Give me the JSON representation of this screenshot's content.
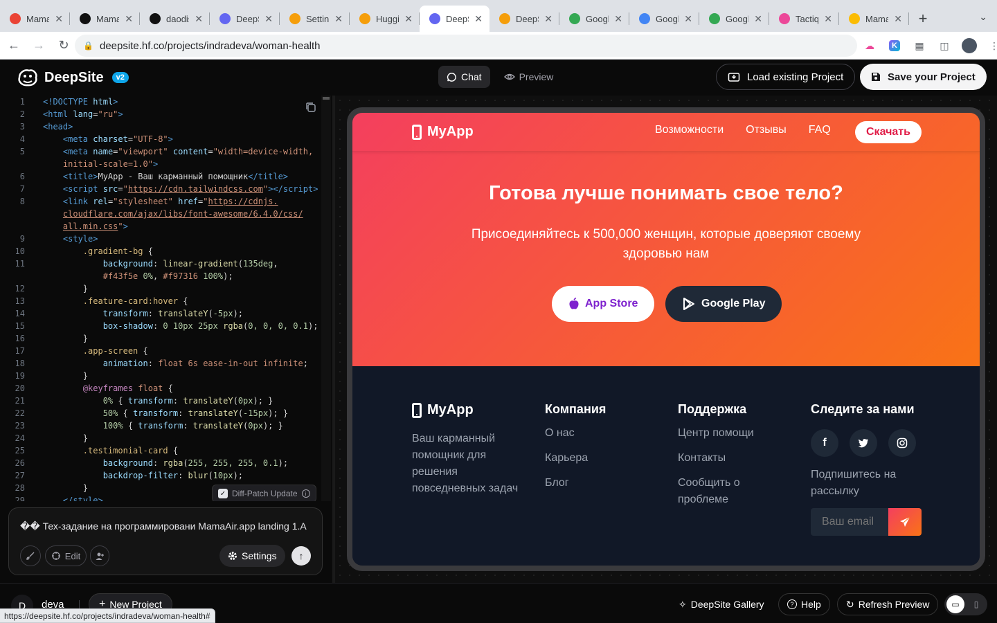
{
  "browser": {
    "tabs": [
      {
        "title": "Mama",
        "color": "#ea4335",
        "icon": "figma-icon"
      },
      {
        "title": "Mama",
        "color": "#111111",
        "icon": "github-icon"
      },
      {
        "title": "daodis",
        "color": "#111111",
        "icon": "github-icon"
      },
      {
        "title": "DeepS",
        "color": "#6366f1",
        "icon": "deepsite-icon"
      },
      {
        "title": "Setting",
        "color": "#f59e0b",
        "icon": "huggingface-icon"
      },
      {
        "title": "Huggin",
        "color": "#f59e0b",
        "icon": "huggingface-icon"
      },
      {
        "title": "DeepS",
        "color": "#6366f1",
        "icon": "deepsite-icon",
        "active": true
      },
      {
        "title": "DeepS",
        "color": "#f59e0b",
        "icon": "deepsite-icon"
      },
      {
        "title": "Google",
        "color": "#34a853",
        "icon": "google-meet-icon"
      },
      {
        "title": "Googl",
        "color": "#4285f4",
        "icon": "google-calendar-icon"
      },
      {
        "title": "Googl",
        "color": "#34a853",
        "icon": "google-meet-icon"
      },
      {
        "title": "Tactiq",
        "color": "#ec4899",
        "icon": "tactiq-icon"
      },
      {
        "title": "Mama",
        "color": "#fbbc04",
        "icon": "google-drive-icon"
      }
    ],
    "url": "deepsite.hf.co/projects/indradeva/woman-health",
    "status_url": "https://deepsite.hf.co/projects/indradeva/woman-health#"
  },
  "app": {
    "name": "DeepSite",
    "version": "v2",
    "mode_chat": "Chat",
    "mode_preview": "Preview",
    "load_project": "Load existing Project",
    "save_project": "Save your Project"
  },
  "editor": {
    "diff_patch": "Diff-Patch Update",
    "lines": [
      {
        "n": "1",
        "html": "<span class='tag'>&lt;!DOCTYPE</span> <span class='attr'>html</span><span class='tag'>&gt;</span>"
      },
      {
        "n": "2",
        "html": "<span class='tag'>&lt;html</span> <span class='attr'>lang</span>=<span class='str'>\"ru\"</span><span class='tag'>&gt;</span>"
      },
      {
        "n": "3",
        "html": "<span class='tag'>&lt;head&gt;</span>"
      },
      {
        "n": "4",
        "html": "    <span class='tag'>&lt;meta</span> <span class='attr'>charset</span>=<span class='str'>\"UTF-8\"</span><span class='tag'>&gt;</span>"
      },
      {
        "n": "5",
        "html": "    <span class='tag'>&lt;meta</span> <span class='attr'>name</span>=<span class='str'>\"viewport\"</span> <span class='attr'>content</span>=<span class='str'>\"width=device-width,</span>"
      },
      {
        "n": "",
        "html": "    <span class='str'>initial-scale=1.0\"</span><span class='tag'>&gt;</span>"
      },
      {
        "n": "6",
        "html": "    <span class='tag'>&lt;title&gt;</span>MyApp - Ваш карманный помощник<span class='tag'>&lt;/title&gt;</span>"
      },
      {
        "n": "7",
        "html": "    <span class='tag'>&lt;script</span> <span class='attr'>src</span>=<span class='str'>\"<u>https://cdn.tailwindcss.com</u>\"</span><span class='tag'>&gt;&lt;/script&gt;</span>"
      },
      {
        "n": "8",
        "html": "    <span class='tag'>&lt;link</span> <span class='attr'>rel</span>=<span class='str'>\"stylesheet\"</span> <span class='attr'>href</span>=<span class='str'>\"<u>https://cdnjs.</u></span>"
      },
      {
        "n": "",
        "html": "    <span class='str'><u>cloudflare.com/ajax/libs/font-awesome/6.4.0/css/</u></span>"
      },
      {
        "n": "",
        "html": "    <span class='str'><u>all.min.css</u>\"</span><span class='tag'>&gt;</span>"
      },
      {
        "n": "9",
        "html": "    <span class='tag'>&lt;style&gt;</span>"
      },
      {
        "n": "10",
        "html": "        <span class='sel'>.gradient-bg</span> {"
      },
      {
        "n": "11",
        "html": "            <span class='prop'>background</span>: <span class='fn'>linear-gradient</span>(<span class='num'>135deg</span>,"
      },
      {
        "n": "",
        "html": "            <span class='val'>#f43f5e</span> <span class='num'>0%</span>, <span class='val'>#f97316</span> <span class='num'>100%</span>);"
      },
      {
        "n": "12",
        "html": "        }"
      },
      {
        "n": "13",
        "html": "        <span class='sel'>.feature-card:hover</span> {"
      },
      {
        "n": "14",
        "html": "            <span class='prop'>transform</span>: <span class='fn'>translateY</span>(<span class='num'>-5px</span>);"
      },
      {
        "n": "15",
        "html": "            <span class='prop'>box-shadow</span>: <span class='num'>0 10px 25px</span> <span class='fn'>rgba</span>(<span class='num'>0, 0, 0, 0.1</span>);"
      },
      {
        "n": "16",
        "html": "        }"
      },
      {
        "n": "17",
        "html": "        <span class='sel'>.app-screen</span> {"
      },
      {
        "n": "18",
        "html": "            <span class='prop'>animation</span>: <span class='val'>float 6s ease-in-out infinite</span>;"
      },
      {
        "n": "19",
        "html": "        }"
      },
      {
        "n": "20",
        "html": "        <span class='kw'>@keyframes</span> <span class='val'>float</span> {"
      },
      {
        "n": "21",
        "html": "            <span class='num'>0%</span> { <span class='prop'>transform</span>: <span class='fn'>translateY</span>(<span class='num'>0px</span>); }"
      },
      {
        "n": "22",
        "html": "            <span class='num'>50%</span> { <span class='prop'>transform</span>: <span class='fn'>translateY</span>(<span class='num'>-15px</span>); }"
      },
      {
        "n": "23",
        "html": "            <span class='num'>100%</span> { <span class='prop'>transform</span>: <span class='fn'>translateY</span>(<span class='num'>0px</span>); }"
      },
      {
        "n": "24",
        "html": "        }"
      },
      {
        "n": "25",
        "html": "        <span class='sel'>.testimonial-card</span> {"
      },
      {
        "n": "26",
        "html": "            <span class='prop'>background</span>: <span class='fn'>rgba</span>(<span class='num'>255, 255, 255, 0.1</span>);"
      },
      {
        "n": "27",
        "html": "            <span class='prop'>backdrop-filter</span>: <span class='fn'>blur</span>(<span class='num'>10px</span>);"
      },
      {
        "n": "28",
        "html": "        }"
      },
      {
        "n": "29",
        "html": "    <span class='tag'>&lt;/style&gt;</span>"
      }
    ]
  },
  "chat": {
    "input_text": "�� Тех-задание на программировани MamaAir.app landing 1.A",
    "edit_label": "Edit",
    "settings_label": "Settings"
  },
  "preview": {
    "brand": "MyApp",
    "nav": [
      "Возможности",
      "Отзывы",
      "FAQ"
    ],
    "download": "Скачать",
    "hero_title": "Готова лучше понимать свое тело?",
    "hero_sub": "Присоединяйтесь к 500,000 женщин, которые доверяют своему здоровью нам",
    "app_store": "App Store",
    "google_play": "Google Play",
    "footer": {
      "brand": "MyApp",
      "description": "Ваш карманный помощник для решения повседневных задач",
      "company_title": "Компания",
      "company_links": [
        "О нас",
        "Карьера",
        "Блог"
      ],
      "support_title": "Поддержка",
      "support_links": [
        "Центр помощи",
        "Контакты",
        "Сообщить о проблеме"
      ],
      "follow_title": "Следите за нами",
      "subscribe": "Подпишитесь на рассылку",
      "email_placeholder": "Ваш email"
    }
  },
  "bottom": {
    "avatar_initial": "D",
    "user": "deva",
    "new_project": "New Project",
    "gallery": "DeepSite Gallery",
    "help": "Help",
    "refresh": "Refresh Preview"
  }
}
